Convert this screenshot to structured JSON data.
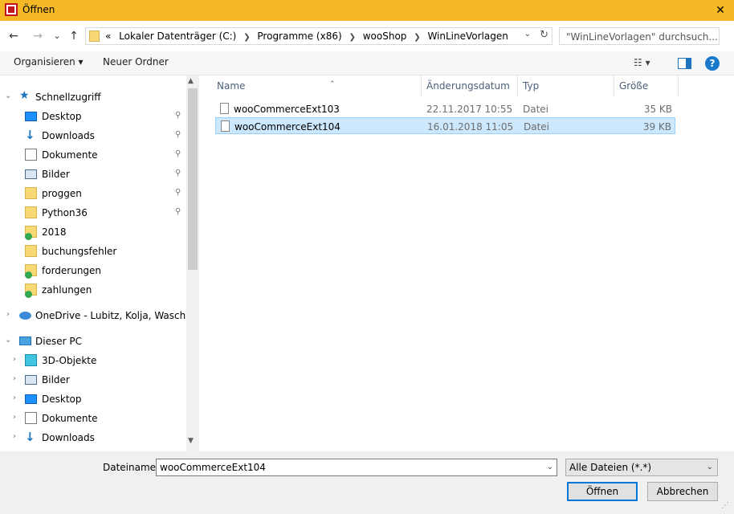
{
  "window": {
    "title": "Öffnen",
    "close_glyph": "✕"
  },
  "nav": {
    "back": "←",
    "forward": "→",
    "recent": "⌄",
    "up": "↑",
    "crumb_prefix": "«",
    "breadcrumbs": [
      "Lokaler Datenträger (C:)",
      "Programme (x86)",
      "wooShop",
      "WinLineVorlagen"
    ],
    "dropdown_glyph": "⌄",
    "refresh_glyph": "↻",
    "search_placeholder": "\"WinLineVorlagen\" durchsuch..."
  },
  "toolbar": {
    "organize": "Organisieren ▾",
    "new_folder": "Neuer Ordner",
    "view_glyph": "☷ ▾",
    "help": "?"
  },
  "navpane": {
    "quick_access": "Schnellzugriff",
    "quick_items": [
      {
        "label": "Desktop",
        "icon": "desktop-icon"
      },
      {
        "label": "Downloads",
        "icon": "downloads-icon"
      },
      {
        "label": "Dokumente",
        "icon": "documents-icon"
      },
      {
        "label": "Bilder",
        "icon": "pictures-icon"
      },
      {
        "label": "proggen",
        "icon": "folder-icon"
      },
      {
        "label": "Python36",
        "icon": "folder-icon"
      },
      {
        "label": "2018",
        "icon": "folder-icon"
      },
      {
        "label": "buchungsfehler",
        "icon": "folder-icon"
      },
      {
        "label": "forderungen",
        "icon": "folder-icon"
      },
      {
        "label": "zahlungen",
        "icon": "folder-icon"
      }
    ],
    "onedrive": "OneDrive - Lubitz, Kolja, Waschkau,",
    "this_pc": "Dieser PC",
    "pc_items": [
      {
        "label": "3D-Objekte",
        "icon": "3d-objects-icon"
      },
      {
        "label": "Bilder",
        "icon": "pictures-icon"
      },
      {
        "label": "Desktop",
        "icon": "desktop-icon"
      },
      {
        "label": "Dokumente",
        "icon": "documents-icon"
      },
      {
        "label": "Downloads",
        "icon": "downloads-icon"
      }
    ],
    "pin_glyph": "📌",
    "expand_glyph": "›",
    "collapse_glyph": "⌄",
    "scroll_up": "▲",
    "scroll_down": "▼"
  },
  "files": {
    "sort_glyph": "⌃",
    "columns": [
      "Name",
      "Änderungsdatum",
      "Typ",
      "Größe"
    ],
    "rows": [
      {
        "name": "wooCommerceExt103",
        "date": "22.11.2017 10:55",
        "type": "Datei",
        "size": "35 KB"
      },
      {
        "name": "wooCommerceExt104",
        "date": "16.01.2018 11:05",
        "type": "Datei",
        "size": "39 KB"
      }
    ]
  },
  "bottom": {
    "filename_label": "Dateiname:",
    "filename_value": "wooCommerceExt104",
    "filter_value": "Alle Dateien (*.*)",
    "dropdown_glyph": "⌄",
    "open_button": "Öffnen",
    "cancel_button": "Abbrechen"
  },
  "colors": {
    "titlebar": "#f4b925",
    "selection": "#cce8ff",
    "accent": "#0078d7"
  }
}
